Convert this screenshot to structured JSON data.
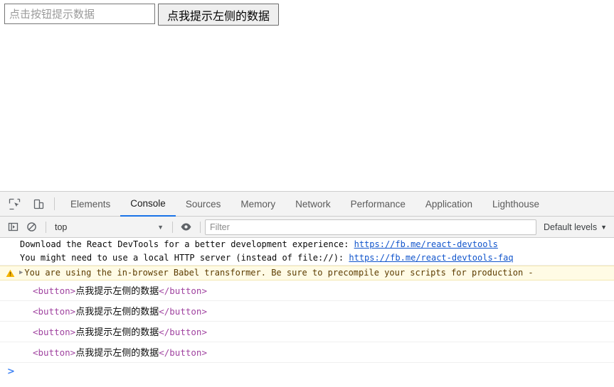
{
  "page": {
    "input_placeholder": "点击按钮提示数据",
    "input_value": "",
    "button_label": "点我提示左侧的数据"
  },
  "devtools": {
    "icons": {
      "inspect": "inspect-element-icon",
      "device": "device-toolbar-icon",
      "sidebar": "console-sidebar-icon",
      "clear": "clear-console-icon",
      "eye": "live-expression-eye-icon"
    },
    "tabs": [
      {
        "label": "Elements",
        "active": false
      },
      {
        "label": "Console",
        "active": true
      },
      {
        "label": "Sources",
        "active": false
      },
      {
        "label": "Memory",
        "active": false
      },
      {
        "label": "Network",
        "active": false
      },
      {
        "label": "Performance",
        "active": false
      },
      {
        "label": "Application",
        "active": false
      },
      {
        "label": "Lighthouse",
        "active": false
      }
    ],
    "toolbar": {
      "context": "top",
      "context_caret": "▼",
      "filter_placeholder": "Filter",
      "filter_value": "",
      "levels_label": "Default levels",
      "levels_caret": "▼"
    },
    "console": {
      "react_msg_1_text": "Download the React DevTools for a better development experience: ",
      "react_msg_1_link": "https://fb.me/react-devtools",
      "react_msg_2_text": "You might need to use a local HTTP server (instead of file://): ",
      "react_msg_2_link": "https://fb.me/react-devtools-faq",
      "warning": {
        "arrow": "▶",
        "icon": "warning-triangle-icon",
        "text": "You are using the in-browser Babel transformer. Be sure to precompile your scripts for production -"
      },
      "element_logs": [
        {
          "open_tag": "<button>",
          "text": "点我提示左侧的数据",
          "close_tag": "</button>"
        },
        {
          "open_tag": "<button>",
          "text": "点我提示左侧的数据",
          "close_tag": "</button>"
        },
        {
          "open_tag": "<button>",
          "text": "点我提示左侧的数据",
          "close_tag": "</button>"
        },
        {
          "open_tag": "<button>",
          "text": "点我提示左侧的数据",
          "close_tag": "</button>"
        }
      ],
      "prompt_caret": ">"
    }
  },
  "colors": {
    "accent": "#1a73e8",
    "link": "#1155cc",
    "tag": "#a043a0",
    "warn_bg": "#fffbe5",
    "prompt": "#4285f4"
  }
}
